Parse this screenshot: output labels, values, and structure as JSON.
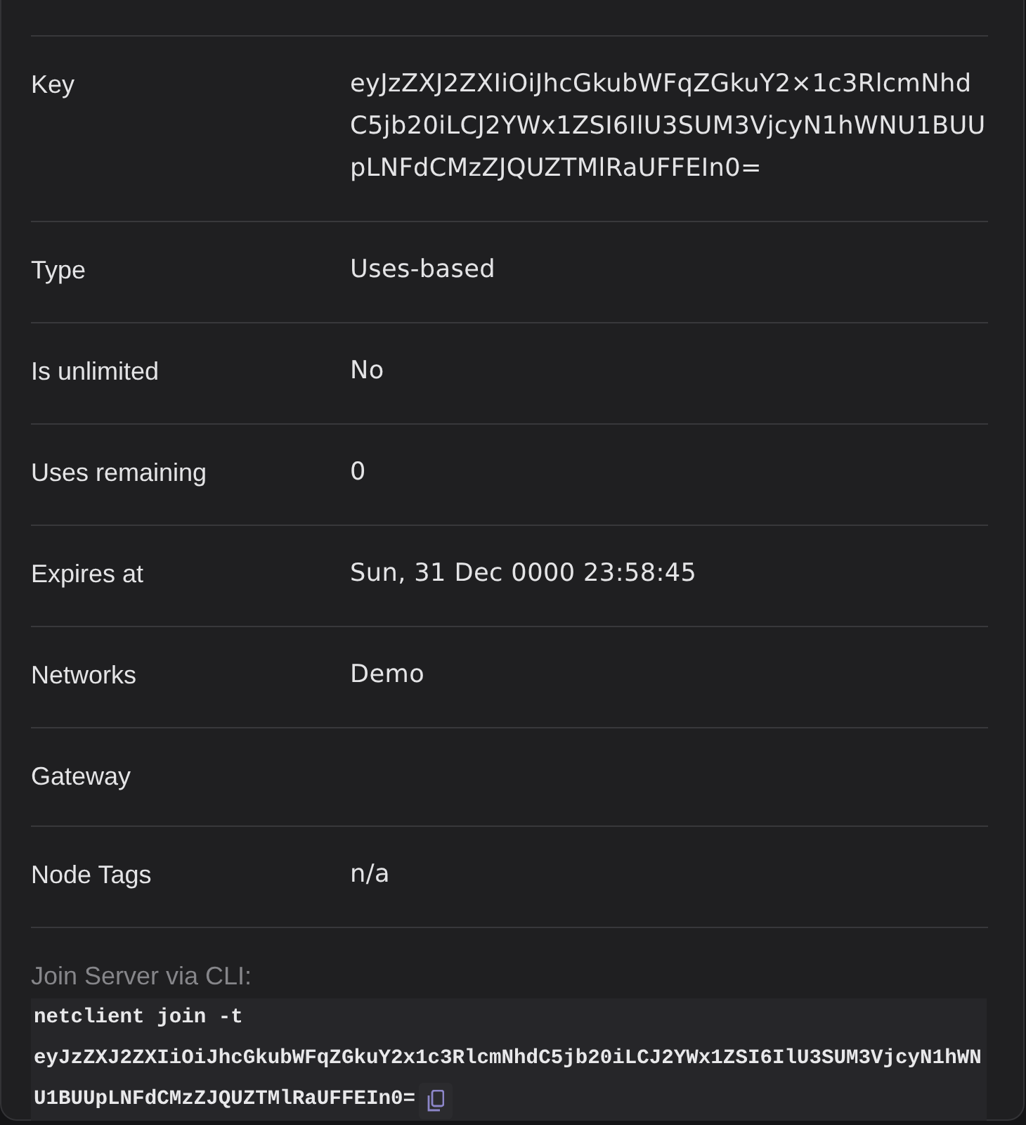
{
  "details": [
    {
      "label": "Key",
      "value": "eyJzZXJ2ZXIiOiJhcGkubWFqZGkuY2×1c3RlcmNhdC5jb20iLCJ2YWx1ZSI6IlU3SUM3VjcyN1hWNU1BUUpLNFdCMzZJQUZTMlRaUFFEIn0="
    },
    {
      "label": "Type",
      "value": "Uses-based"
    },
    {
      "label": "Is unlimited",
      "value": "No"
    },
    {
      "label": "Uses remaining",
      "value": "0"
    },
    {
      "label": "Expires at",
      "value": "Sun, 31 Dec 0000 23:58:45"
    },
    {
      "label": "Networks",
      "value": "Demo"
    },
    {
      "label": "Gateway"
    },
    {
      "label": "Node Tags",
      "value": "n/a"
    }
  ],
  "cli": {
    "label": "Join Server via CLI:",
    "command": "netclient join -t eyJzZXJ2ZXIiOiJhcGkubWFqZGkuY2x1c3RlcmNhdC5jb20iLCJ2YWx1ZSI6IlU3SUM3VjcyN1hWNU1BUUpLNFdCMzZJQUZTMlRaUFFEIn0="
  }
}
